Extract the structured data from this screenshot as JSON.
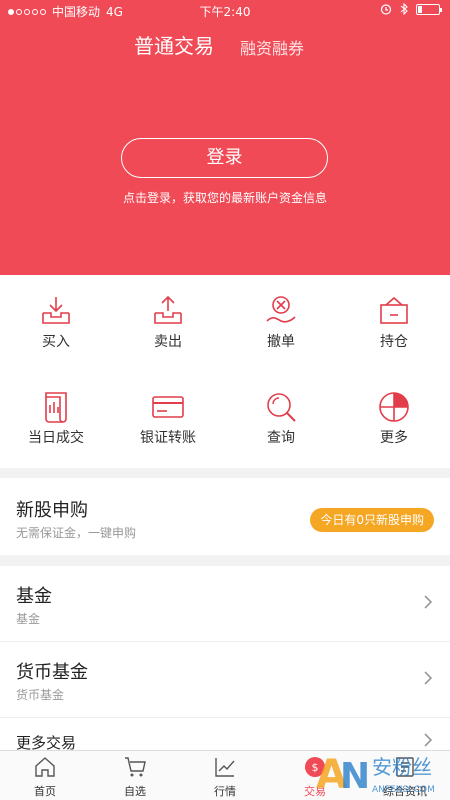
{
  "status_bar": {
    "carrier": "中国移动",
    "network": "4G",
    "time": "下午2:40"
  },
  "header": {
    "tab_active": "普通交易",
    "tab_other": "融资融券",
    "login_button": "登录",
    "login_hint": "点击登录，获取您的最新账户资金信息",
    "background_color": "#f04a57"
  },
  "functions": [
    {
      "label": "买入",
      "icon": "download-tray-icon"
    },
    {
      "label": "卖出",
      "icon": "upload-tray-icon"
    },
    {
      "label": "撤单",
      "icon": "cancel-order-icon"
    },
    {
      "label": "持仓",
      "icon": "holdings-box-icon"
    },
    {
      "label": "当日成交",
      "icon": "scroll-document-icon"
    },
    {
      "label": "银证转账",
      "icon": "bank-card-icon"
    },
    {
      "label": "查询",
      "icon": "magnifier-icon"
    },
    {
      "label": "更多",
      "icon": "pie-grid-icon"
    }
  ],
  "ipo": {
    "title": "新股申购",
    "subtitle": "无需保证金，一键申购",
    "badge": "今日有0只新股申购",
    "badge_color": "#f5a623"
  },
  "list": [
    {
      "title": "基金",
      "subtitle": "基金"
    },
    {
      "title": "货币基金",
      "subtitle": "货币基金"
    },
    {
      "title": "更多交易",
      "subtitle": ""
    }
  ],
  "nav": [
    {
      "label": "首页",
      "icon": "home-icon"
    },
    {
      "label": "自选",
      "icon": "cart-icon"
    },
    {
      "label": "行情",
      "icon": "trend-chart-icon"
    },
    {
      "label": "交易",
      "icon": "trade-coin-icon"
    },
    {
      "label": "综合资讯",
      "icon": "news-icon"
    }
  ],
  "watermark": {
    "text": "安粉丝",
    "url_text": "ANFENSI.COM"
  }
}
